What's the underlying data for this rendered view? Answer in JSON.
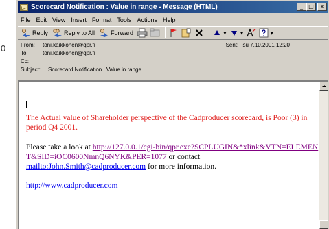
{
  "left_strip": {
    "char": "0"
  },
  "window": {
    "title": "Scorecard Notification : Value in range - Message (HTML)",
    "controls": {
      "minimize": "_",
      "maximize": "□",
      "close": "×"
    }
  },
  "menu": [
    "File",
    "Edit",
    "View",
    "Insert",
    "Format",
    "Tools",
    "Actions",
    "Help"
  ],
  "toolbar": {
    "reply": "Reply",
    "reply_all": "Reply to All",
    "forward": "Forward"
  },
  "header": {
    "from_label": "From:",
    "from_value": "toni.kaikkonen@qpr.fi",
    "to_label": "To:",
    "to_value": "toni.kaikkonen@qpr.fi",
    "cc_label": "Cc:",
    "cc_value": "",
    "subject_label": "Subject:",
    "subject_value": "Scorecard Notification : Value in range",
    "sent_label": "Sent:",
    "sent_value": "su 7.10.2001 12:20"
  },
  "body": {
    "alert": "The Actual value of Shareholder perspective of the Cadproducer scorecard, is Poor (3) in period Q4 2001.",
    "info_prefix": "Please take a look at",
    "link_url": "http://127.0.0.1/cgi-bin/qpr.exe?SCPLUGIN&*xlink&VTN=ELEMENT&SID=iOC0600NmnQ6NYK&PER=1077",
    "info_or": "or contact",
    "mailto": "mailto:John.Smith@cadproducer.com",
    "info_suffix": "for more information.",
    "site_link": "http://www.cadproducer.com"
  },
  "colors": {
    "titlebar": "#0a246a",
    "alert_text": "#e0201e",
    "visited_link": "#800080",
    "link": "#0000ee",
    "chrome": "#d4d0c8"
  }
}
